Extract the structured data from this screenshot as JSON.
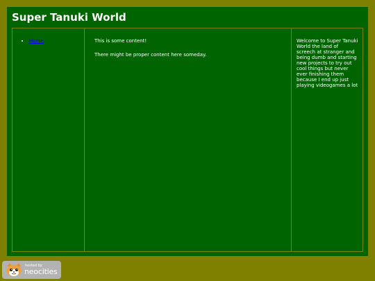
{
  "site": {
    "title": "Super Tanuki World"
  },
  "nav": {
    "items": [
      {
        "label": "Home"
      }
    ]
  },
  "main": {
    "paragraphs": [
      "This is some content!",
      "There might be proper content here someday."
    ]
  },
  "sidebar": {
    "text": "Welcome to Super Tanuki World the land of screech at stranger and being dumb and starting new projects to try out cool things but never ever finishing them because I end up just playing videogames a lot"
  },
  "badge": {
    "small_text": "hosted by",
    "big_text": "neocities",
    "icon": "neocities-cat-icon"
  },
  "colors": {
    "background": "#808000",
    "panel": "#006400",
    "text": "#ffffff",
    "link": "#0000ee",
    "border": "#808000"
  }
}
